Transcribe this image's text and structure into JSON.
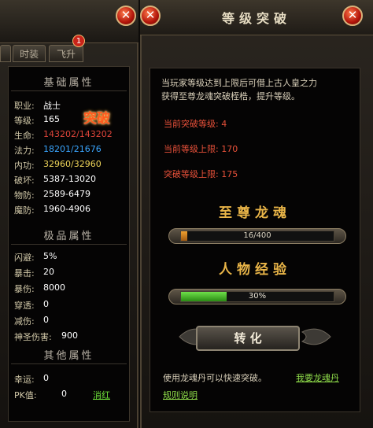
{
  "left": {
    "tabs": [
      "时装",
      "飞升"
    ],
    "badge": "1",
    "sections": {
      "basic": "基础属性",
      "premium": "极品属性",
      "other": "其他属性"
    },
    "breakthrough_tag": "突破",
    "basic_rows": [
      {
        "label": "职业:",
        "value": "战士",
        "color": "#ffffff"
      },
      {
        "label": "等级:",
        "value": "165",
        "color": "#ffffff"
      },
      {
        "label": "生命:",
        "value": "143202/143202",
        "color": "#e0453a"
      },
      {
        "label": "法力:",
        "value": "18201/21676",
        "color": "#3aa6ff"
      },
      {
        "label": "内功:",
        "value": "32960/32960",
        "color": "#f0d65a"
      },
      {
        "label": "破坏:",
        "value": "5387-13020",
        "color": "#ffffff"
      },
      {
        "label": "物防:",
        "value": "2589-6479",
        "color": "#ffffff"
      },
      {
        "label": "魔防:",
        "value": "1960-4906",
        "color": "#ffffff"
      }
    ],
    "premium_rows": [
      {
        "label": "闪避:",
        "value": "5%"
      },
      {
        "label": "暴击:",
        "value": "20"
      },
      {
        "label": "暴伤:",
        "value": "8000"
      },
      {
        "label": "穿透:",
        "value": "0"
      },
      {
        "label": "减伤:",
        "value": "0"
      },
      {
        "label": "神圣伤害:",
        "value": "900"
      }
    ],
    "other_rows": [
      {
        "label": "幸运:",
        "value": "0"
      },
      {
        "label": "PK值:",
        "value": "0"
      }
    ],
    "clear_red": "消红"
  },
  "right": {
    "title": "等级突破",
    "desc": [
      "当玩家等级达到上限后可借上古人皇之力",
      "获得至尊龙魂突破桎梏，提升等级。"
    ],
    "info": [
      {
        "label": "当前突破等级:",
        "value": "4"
      },
      {
        "label": "当前等级上限:",
        "value": "170"
      },
      {
        "label": "突破等级上限:",
        "value": "175"
      }
    ],
    "dragon_soul": {
      "title": "至尊龙魂",
      "text": "16/400",
      "progress": 0.04
    },
    "experience": {
      "title": "人物经验",
      "text": "30%",
      "progress": 0.3
    },
    "convert_button": "转 化",
    "hint": "使用龙魂丹可以快速突破。",
    "want_link": "我要龙魂丹",
    "rules_link": "规则说明"
  },
  "icons": {
    "close": "close-icon",
    "ornament": "dragon-ornament"
  }
}
